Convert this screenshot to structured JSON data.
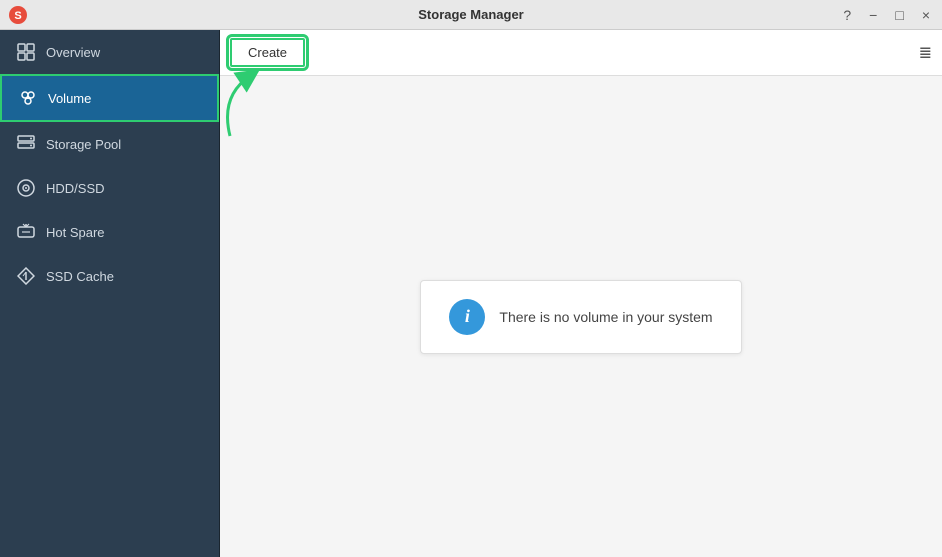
{
  "window": {
    "title": "Storage Manager",
    "controls": {
      "help": "?",
      "minimize": "−",
      "restore": "□",
      "close": "×"
    }
  },
  "sidebar": {
    "items": [
      {
        "id": "overview",
        "label": "Overview",
        "active": false
      },
      {
        "id": "volume",
        "label": "Volume",
        "active": true
      },
      {
        "id": "storage-pool",
        "label": "Storage Pool",
        "active": false
      },
      {
        "id": "hdd-ssd",
        "label": "HDD/SSD",
        "active": false
      },
      {
        "id": "hot-spare",
        "label": "Hot Spare",
        "active": false
      },
      {
        "id": "ssd-cache",
        "label": "SSD Cache",
        "active": false
      }
    ]
  },
  "toolbar": {
    "create_label": "Create"
  },
  "main": {
    "empty_message": "There is no volume in your system"
  },
  "colors": {
    "accent_green": "#2ecc71",
    "sidebar_bg": "#2c3e50",
    "active_bg": "#1a6496",
    "info_blue": "#3498db"
  }
}
